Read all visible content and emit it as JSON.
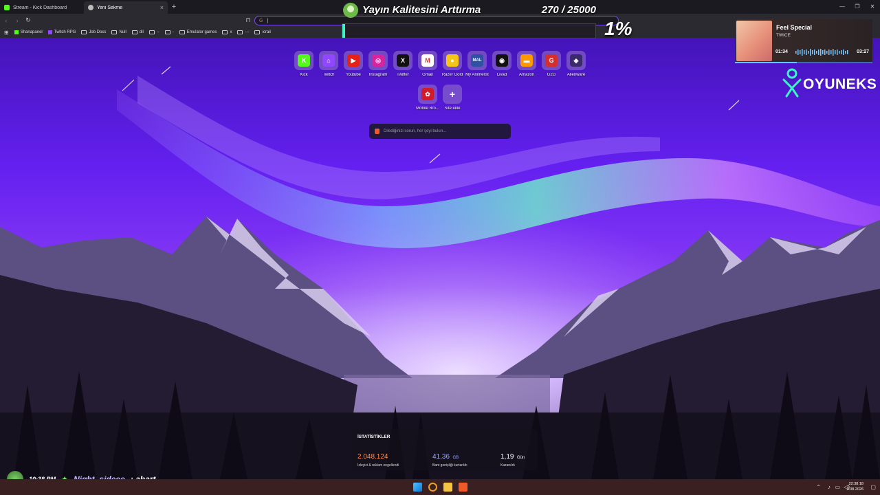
{
  "browser": {
    "tabs": [
      {
        "label": "Stream - Kick Dashboard",
        "active": false,
        "favicon_color": "#53fc18"
      },
      {
        "label": "Yeni Sekme",
        "active": true,
        "favicon_color": "#bbbbbb"
      }
    ],
    "new_tab_icon": "plus-icon",
    "omnibox_value": "",
    "bookmarks": [
      {
        "label": "Shanapanel",
        "icon": "kick-favicon"
      },
      {
        "label": "Twitch RPG",
        "icon": "twitch-favicon"
      },
      {
        "label": "Job Docs",
        "icon": "folder-icon"
      },
      {
        "label": "Null",
        "icon": "folder-icon"
      },
      {
        "label": "dil",
        "icon": "folder-icon"
      },
      {
        "label": "--",
        "icon": "folder-icon"
      },
      {
        "label": "-",
        "icon": "folder-icon"
      },
      {
        "label": "Emulator games",
        "icon": "folder-icon"
      },
      {
        "label": "x",
        "icon": "folder-icon"
      },
      {
        "label": "---",
        "icon": "folder-icon"
      },
      {
        "label": "icrail",
        "icon": "folder-icon"
      }
    ]
  },
  "goal": {
    "title": "Yayın Kalitesini Arttırma",
    "count": "270 / 25000",
    "percent_label": "1%",
    "progress": 0.011
  },
  "music": {
    "title": "Feel Special",
    "artist": "TWICE",
    "current": "01:34",
    "total": "03:27",
    "progress": 0.45
  },
  "logo": {
    "text": "OYUNEKS"
  },
  "speed_dial": [
    {
      "label": "Kick",
      "icon": "kick-icon",
      "color": "#53fc18",
      "glyph": "K"
    },
    {
      "label": "Twitch",
      "icon": "twitch-icon",
      "color": "#9146ff",
      "glyph": "⌂"
    },
    {
      "label": "Youtube",
      "icon": "youtube-icon",
      "color": "#e62117",
      "glyph": "▶"
    },
    {
      "label": "Instagram",
      "icon": "instagram-icon",
      "color": "#d6249f",
      "glyph": "◎"
    },
    {
      "label": "Twitter",
      "icon": "twitter-icon",
      "color": "#111111",
      "glyph": "X"
    },
    {
      "label": "Gmail",
      "icon": "gmail-icon",
      "color": "#ffffff",
      "glyph": "M"
    },
    {
      "label": "Razer Gold",
      "icon": "razer-gold-icon",
      "color": "#f5c518",
      "glyph": "●"
    },
    {
      "label": "My Animelist",
      "icon": "myanimelist-icon",
      "color": "#2e51a2",
      "glyph": "MAL"
    },
    {
      "label": "Livad",
      "icon": "livad-icon",
      "color": "#111111",
      "glyph": "◉"
    },
    {
      "label": "Amazon",
      "icon": "amazon-icon",
      "color": "#ff9900",
      "glyph": "▬"
    },
    {
      "label": "G2G",
      "icon": "g2g-icon",
      "color": "#d32f2f",
      "glyph": "G"
    },
    {
      "label": "Alienware",
      "icon": "alienware-icon",
      "color": "#3b2a6b",
      "glyph": "◈"
    },
    {
      "label": "Mobile Bro...",
      "icon": "huawei-icon",
      "color": "#d11a2a",
      "glyph": "✿"
    },
    {
      "label": "Site ekle",
      "icon": "add-site-icon",
      "color": "transparent",
      "glyph": "+"
    }
  ],
  "search": {
    "placeholder": "Dilediğinizi sorun, her şeyi bulun...",
    "icon": "brave-lion-icon"
  },
  "stats": {
    "title": "İSTATİSTİKLER",
    "items": [
      {
        "value": "2.048.124",
        "unit": "",
        "desc": "İzleyici & reklam engellendi",
        "color": "#ff8a4c"
      },
      {
        "value": "41,36",
        "unit": "GB",
        "desc": "Bant genişliği kurtarıldı",
        "color": "#9aa6ff"
      },
      {
        "value": "1,19",
        "unit": "Gün",
        "desc": "Kazanıldı",
        "color": "#ffffff"
      }
    ]
  },
  "chat": {
    "time": "10:38 PM",
    "user": "Night_sideee",
    "message": ": abart"
  },
  "taskbar": {
    "time": "22:38:18",
    "date": "3.08.2026"
  }
}
